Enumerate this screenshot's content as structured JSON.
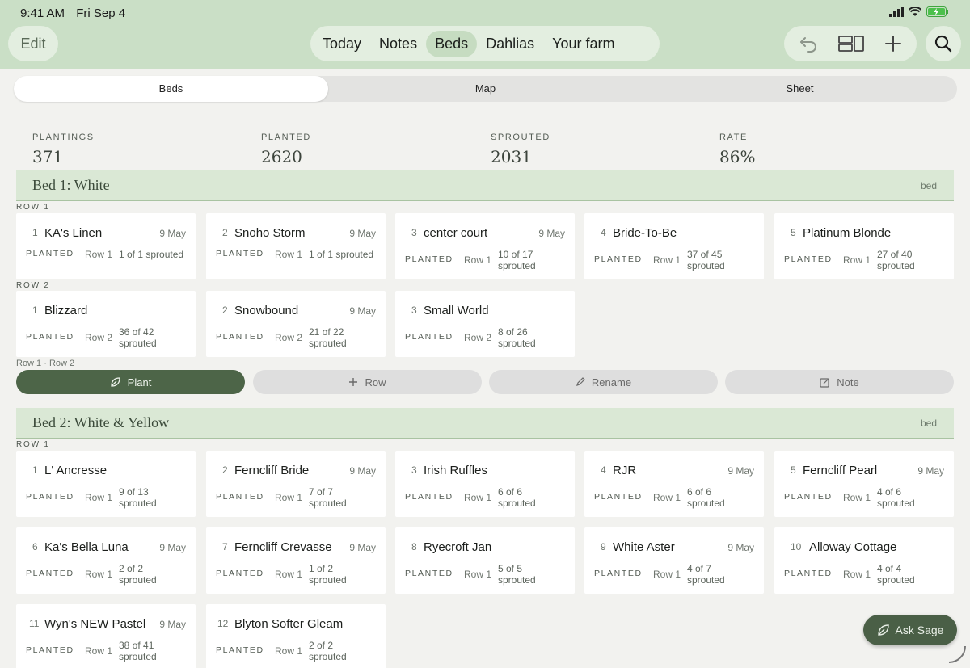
{
  "status_bar": {
    "time": "9:41 AM",
    "date": "Fri Sep 4"
  },
  "header": {
    "edit_label": "Edit",
    "nav": [
      "Today",
      "Notes",
      "Beds",
      "Dahlias",
      "Your farm"
    ],
    "active_nav": "Beds"
  },
  "segments": [
    "Beds",
    "Map",
    "Sheet"
  ],
  "stats": [
    {
      "label": "PLANTINGS",
      "value": "371"
    },
    {
      "label": "PLANTED",
      "value": "2620"
    },
    {
      "label": "SPROUTED",
      "value": "2031"
    },
    {
      "label": "RATE",
      "value": "86%"
    }
  ],
  "beds": [
    {
      "title": "Bed 1: White",
      "tag": "bed",
      "rows": [
        {
          "label": "ROW 1",
          "cards": [
            {
              "num": "1",
              "name": "KA's Linen",
              "date": "9 May",
              "status": "PLANTED",
              "row": "Row 1",
              "sprouted": "1 of 1 sprouted"
            },
            {
              "num": "2",
              "name": "Snoho Storm",
              "date": "9 May",
              "status": "PLANTED",
              "row": "Row 1",
              "sprouted": "1 of 1 sprouted"
            },
            {
              "num": "3",
              "name": "center court",
              "date": "9 May",
              "status": "PLANTED",
              "row": "Row 1",
              "sprouted": "10 of 17 sprouted"
            },
            {
              "num": "4",
              "name": "Bride-To-Be",
              "date": "",
              "status": "PLANTED",
              "row": "Row 1",
              "sprouted": "37 of 45 sprouted"
            },
            {
              "num": "5",
              "name": "Platinum Blonde",
              "date": "",
              "status": "PLANTED",
              "row": "Row 1",
              "sprouted": "27 of 40 sprouted"
            }
          ]
        },
        {
          "label": "ROW 2",
          "cards": [
            {
              "num": "1",
              "name": "Blizzard",
              "date": "",
              "status": "PLANTED",
              "row": "Row 2",
              "sprouted": "36 of 42 sprouted"
            },
            {
              "num": "2",
              "name": "Snowbound",
              "date": "9 May",
              "status": "PLANTED",
              "row": "Row 2",
              "sprouted": "21 of 22 sprouted"
            },
            {
              "num": "3",
              "name": "Small World",
              "date": "",
              "status": "PLANTED",
              "row": "Row 2",
              "sprouted": "8 of 26 sprouted"
            }
          ]
        }
      ],
      "rows_meta": "Row 1 · Row 2",
      "actions": [
        "Plant",
        "Row",
        "Rename",
        "Note"
      ]
    },
    {
      "title": "Bed 2: White & Yellow",
      "tag": "bed",
      "rows": [
        {
          "label": "ROW 1",
          "cards": [
            {
              "num": "1",
              "name": "L' Ancresse",
              "date": "",
              "status": "PLANTED",
              "row": "Row 1",
              "sprouted": "9 of 13 sprouted"
            },
            {
              "num": "2",
              "name": "Ferncliff Bride",
              "date": "9 May",
              "status": "PLANTED",
              "row": "Row 1",
              "sprouted": "7 of 7 sprouted"
            },
            {
              "num": "3",
              "name": "Irish Ruffles",
              "date": "",
              "status": "PLANTED",
              "row": "Row 1",
              "sprouted": "6 of 6 sprouted"
            },
            {
              "num": "4",
              "name": "RJR",
              "date": "9 May",
              "status": "PLANTED",
              "row": "Row 1",
              "sprouted": "6 of 6 sprouted"
            },
            {
              "num": "5",
              "name": "Ferncliff Pearl",
              "date": "9 May",
              "status": "PLANTED",
              "row": "Row 1",
              "sprouted": "4 of 6 sprouted"
            },
            {
              "num": "6",
              "name": "Ka's Bella Luna",
              "date": "9 May",
              "status": "PLANTED",
              "row": "Row 1",
              "sprouted": "2 of 2 sprouted"
            },
            {
              "num": "7",
              "name": "Ferncliff Crevasse",
              "date": "9 May",
              "status": "PLANTED",
              "row": "Row 1",
              "sprouted": "1 of 2 sprouted"
            },
            {
              "num": "8",
              "name": "Ryecroft Jan",
              "date": "",
              "status": "PLANTED",
              "row": "Row 1",
              "sprouted": "5 of 5 sprouted"
            },
            {
              "num": "9",
              "name": "White Aster",
              "date": "9 May",
              "status": "PLANTED",
              "row": "Row 1",
              "sprouted": "4 of 7 sprouted"
            },
            {
              "num": "10",
              "name": "Alloway Cottage",
              "date": "",
              "status": "PLANTED",
              "row": "Row 1",
              "sprouted": "4 of 4 sprouted"
            },
            {
              "num": "11",
              "name": "Wyn's NEW Pastel",
              "date": "9 May",
              "status": "PLANTED",
              "row": "Row 1",
              "sprouted": "38 of 41 sprouted"
            },
            {
              "num": "12",
              "name": "Blyton Softer Gleam",
              "date": "",
              "status": "PLANTED",
              "row": "Row 1",
              "sprouted": "2 of 2 sprouted"
            }
          ]
        }
      ]
    }
  ],
  "ask_sage_label": "Ask Sage",
  "colors": {
    "header_bg": "#cadfc6",
    "bed_header_bg": "#dae8d5",
    "primary_button": "#4d6548",
    "page_bg": "#f2f2ef"
  }
}
